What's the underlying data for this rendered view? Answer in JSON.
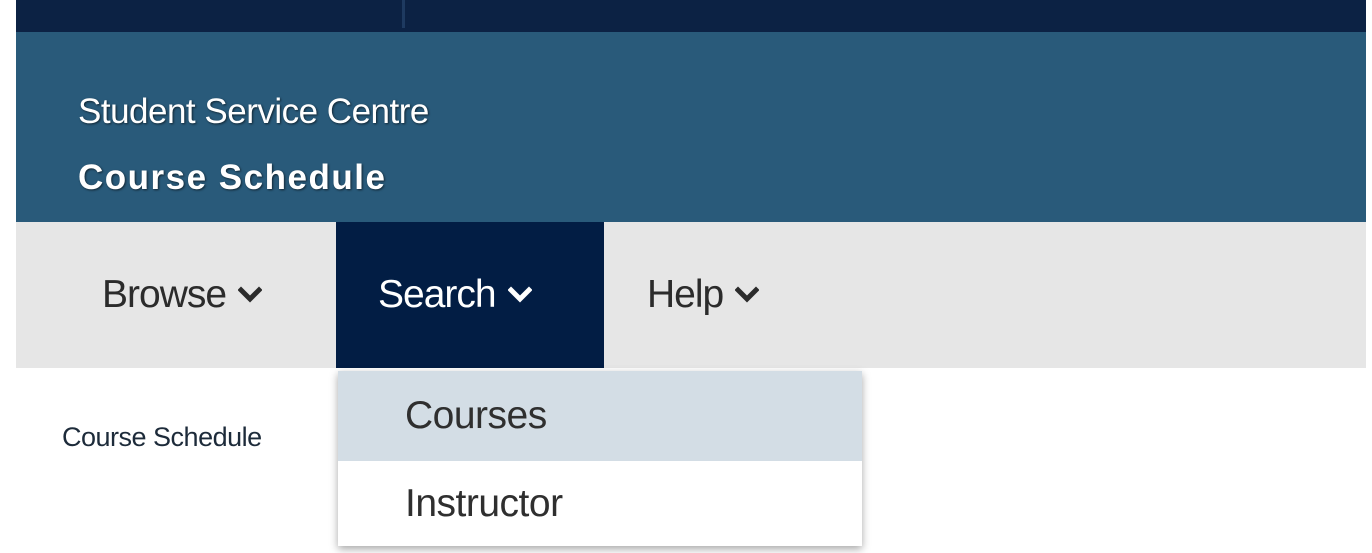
{
  "banner": {
    "line1": "Student Service Centre",
    "line2": "Course Schedule"
  },
  "nav": {
    "items": [
      {
        "label": "Browse",
        "icon": "chevron-down-icon",
        "active": false
      },
      {
        "label": "Search",
        "icon": "chevron-down-icon",
        "active": true
      },
      {
        "label": "Help",
        "icon": "chevron-down-icon",
        "active": false
      }
    ]
  },
  "breadcrumb": {
    "text": "Course Schedule"
  },
  "dropdown": {
    "items": [
      {
        "label": "Courses",
        "highlighted": true
      },
      {
        "label": "Instructor",
        "highlighted": false
      }
    ]
  },
  "colors": {
    "top_bar": "#0c2244",
    "banner": "#295a7a",
    "nav_bg": "#e6e6e6",
    "nav_active": "#021d44",
    "dropdown_highlight": "#d3dde5"
  }
}
